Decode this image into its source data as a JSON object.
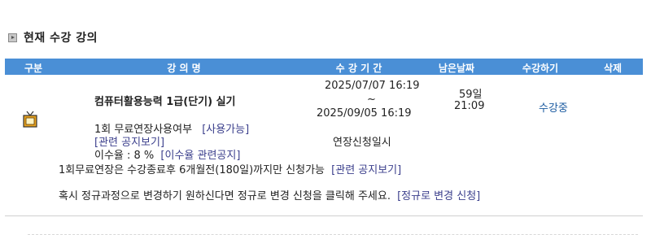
{
  "section": {
    "title": "현재 수강 강의"
  },
  "table_header": {
    "type": "구분",
    "course_name": "강 의 명",
    "period": "수 강 기 간",
    "remaining": "남은날짜",
    "enroll": "수강하기",
    "delete": "삭제"
  },
  "course": {
    "title": "컴퓨터활용능력 1급(단기) 실기",
    "start": "2025/07/07 16:19",
    "tilde": "~",
    "end": "2025/09/05 16:19",
    "remaining_days": "59일",
    "remaining_time": "21:09",
    "status": "수강중",
    "extension_text": "1회 무료연장사용여부",
    "extension_available": "[사용가능]",
    "notice_link": "[관련 공지보기]",
    "extension_apply": "연장신청일시",
    "completion_text": "이수율 : 8 %",
    "completion_link": "[이수율 관련공지]"
  },
  "notes": {
    "extension_note": "1회무료연장은 수강종료후 6개월전(180일)까지만 신청가능",
    "extension_note_link": "[관련 공지보기]",
    "switch_note": "혹시 정규과정으로 변경하기 원하신다면 정규로 변경 신청을 클릭해 주세요.",
    "switch_link": "[정규로 변경 신청]"
  },
  "icons": {
    "section_bullet": "bullet-square-icon",
    "course_type": "tv-icon"
  },
  "colors": {
    "header_bg": "#4a8fd6",
    "status": "#1a5aa0",
    "link": "#3b3f8c"
  }
}
